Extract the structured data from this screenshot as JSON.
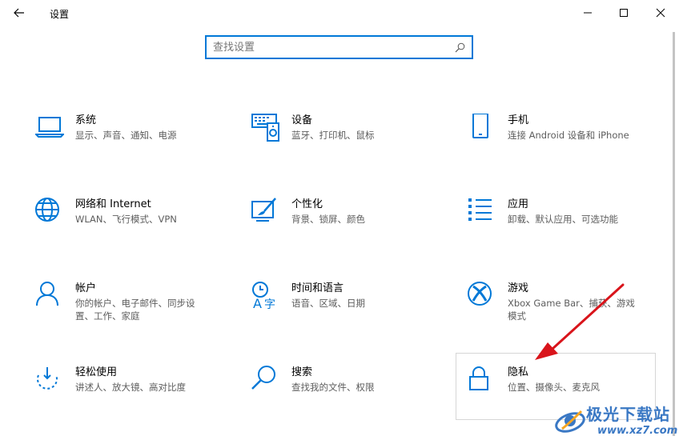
{
  "window": {
    "title": "设置",
    "controls": [
      "minimize",
      "maximize",
      "close"
    ]
  },
  "search": {
    "placeholder": "查找设置",
    "value": ""
  },
  "tiles": [
    {
      "name": "系统",
      "desc": "显示、声音、通知、电源",
      "icon": "laptop-icon"
    },
    {
      "name": "设备",
      "desc": "蓝牙、打印机、鼠标",
      "icon": "devices-icon"
    },
    {
      "name": "手机",
      "desc": "连接 Android 设备和 iPhone",
      "icon": "phone-icon"
    },
    {
      "name": "网络和 Internet",
      "desc": "WLAN、飞行模式、VPN",
      "icon": "globe-icon"
    },
    {
      "name": "个性化",
      "desc": "背景、锁屏、颜色",
      "icon": "personalization-icon"
    },
    {
      "name": "应用",
      "desc": "卸载、默认应用、可选功能",
      "icon": "apps-list-icon"
    },
    {
      "name": "帐户",
      "desc": "你的帐户、电子邮件、同步设置、工作、家庭",
      "icon": "person-icon"
    },
    {
      "name": "时间和语言",
      "desc": "语音、区域、日期",
      "icon": "time-language-icon"
    },
    {
      "name": "游戏",
      "desc": "Xbox Game Bar、捕获、游戏模式",
      "icon": "xbox-icon"
    },
    {
      "name": "轻松使用",
      "desc": "讲述人、放大镜、高对比度",
      "icon": "ease-of-access-icon"
    },
    {
      "name": "搜索",
      "desc": "查找我的文件、权限",
      "icon": "search-icon"
    },
    {
      "name": "隐私",
      "desc": "位置、摄像头、麦克风",
      "icon": "lock-icon"
    }
  ],
  "watermark": {
    "text": "极光下载站",
    "url": "www.xz7.com"
  },
  "colors": {
    "accent": "#0078d7",
    "annotation_arrow": "#d9141b"
  }
}
